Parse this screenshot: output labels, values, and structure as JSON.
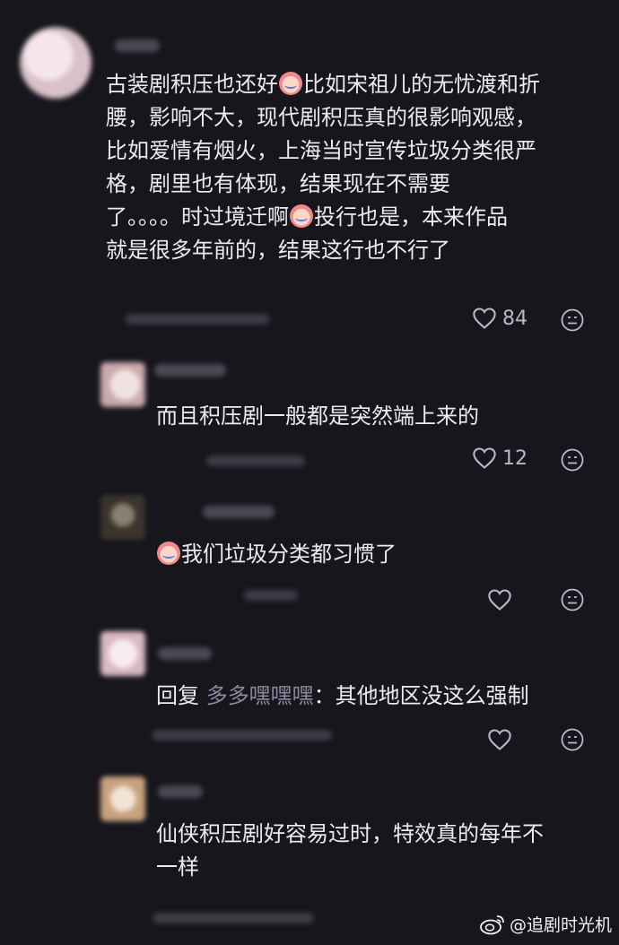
{
  "comments": [
    {
      "text_lines": [
        "古装剧积压也还好",
        "比如宋祖儿的无忧渡和折",
        "腰，影响不大，现代剧积压真的很影响观感，",
        "比如爱情有烟火，上海当时宣传垃圾分类很严",
        "格，剧里也有体现，结果现在不需要",
        "了。。。。时过境迁啊",
        "投行也是，本来作品",
        "就是很多年前的，结果这行也不行了"
      ],
      "likes": "84"
    },
    {
      "text": "而且积压剧一般都是突然端上来的",
      "likes": "12"
    },
    {
      "text": "我们垃圾分类都习惯了",
      "likes": ""
    },
    {
      "reply_prefix": "回复",
      "mention": "多多嘿嘿嘿",
      "text": "：其他地区没这么强制",
      "likes": ""
    },
    {
      "text_lines": [
        "仙侠积压剧好容易过时，特效真的每年不",
        "一样"
      ],
      "likes": ""
    }
  ],
  "watermark": "@追剧时光机",
  "icons": {
    "like": "heart-outline-icon",
    "reply": "comment-face-icon",
    "watermark": "weibo-logo-icon"
  },
  "colors": {
    "background": "#16161c",
    "text": "#ececef",
    "mention": "#8a8aa0",
    "icon": "#b9b9c2"
  }
}
